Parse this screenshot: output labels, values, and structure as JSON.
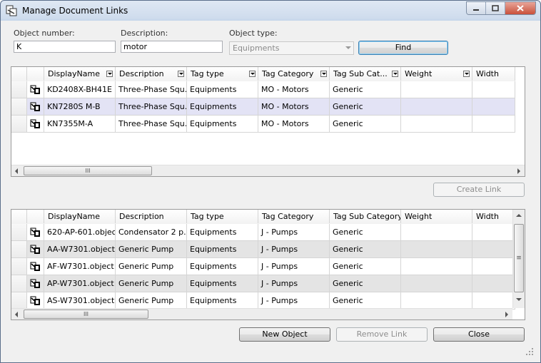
{
  "window": {
    "title": "Manage Document Links"
  },
  "search": {
    "object_number_label": "Object number:",
    "object_number_value": "K",
    "description_label": "Description:",
    "description_value": "motor",
    "object_type_label": "Object type:",
    "object_type_value": "Equipments",
    "find_label": "Find"
  },
  "top_grid": {
    "columns": [
      "DisplayName",
      "Description",
      "Tag type",
      "Tag Category",
      "Tag Sub Cat...",
      "Weight",
      "Width"
    ],
    "rows": [
      {
        "display_name": "KD2408X-BH41E",
        "description": "Three-Phase Squ...",
        "tag_type": "Equipments",
        "tag_category": "MO - Motors",
        "tag_sub_category": "Generic",
        "weight": "",
        "width": ""
      },
      {
        "display_name": "KN7280S M-B",
        "description": "Three-Phase Squ...",
        "tag_type": "Equipments",
        "tag_category": "MO - Motors",
        "tag_sub_category": "Generic",
        "weight": "",
        "width": ""
      },
      {
        "display_name": "KN7355M-A",
        "description": "Three-Phase Squ...",
        "tag_type": "Equipments",
        "tag_category": "MO - Motors",
        "tag_sub_category": "Generic",
        "weight": "",
        "width": ""
      }
    ],
    "selected_row": 1,
    "scroll_thumb_glyph": "III"
  },
  "create_link_label": "Create Link",
  "bottom_grid": {
    "columns": [
      "DisplayName",
      "Description",
      "Tag type",
      "Tag Category",
      "Tag Sub Category",
      "Weight",
      "Width"
    ],
    "rows": [
      {
        "display_name": "620-AP-601.object",
        "description": "Condensator 2 p...",
        "tag_type": "Equipments",
        "tag_category": "J - Pumps",
        "tag_sub_category": "Generic",
        "weight": "",
        "width": ""
      },
      {
        "display_name": "AA-W7301.object",
        "description": "Generic Pump",
        "tag_type": "Equipments",
        "tag_category": "J - Pumps",
        "tag_sub_category": "Generic",
        "weight": "",
        "width": ""
      },
      {
        "display_name": "AF-W7301.object",
        "description": "Generic Pump",
        "tag_type": "Equipments",
        "tag_category": "J - Pumps",
        "tag_sub_category": "Generic",
        "weight": "",
        "width": ""
      },
      {
        "display_name": "AP-W7301.object",
        "description": "Generic Pump",
        "tag_type": "Equipments",
        "tag_category": "J - Pumps",
        "tag_sub_category": "Generic",
        "weight": "",
        "width": ""
      },
      {
        "display_name": "AS-W7301.object",
        "description": "Generic Pump",
        "tag_type": "Equipments",
        "tag_category": "J - Pumps",
        "tag_sub_category": "Generic",
        "weight": "",
        "width": ""
      }
    ],
    "scroll_thumb_glyph": "III",
    "vscroll_thumb_glyph": "≡"
  },
  "buttons": {
    "new_object": "New Object",
    "remove_link": "Remove Link",
    "close": "Close"
  },
  "colors": {
    "selected_row": "#e3e3f5",
    "alt_row": "#e4e4e4",
    "title_bar": "#cfdced",
    "close_button": "#c9503b"
  }
}
